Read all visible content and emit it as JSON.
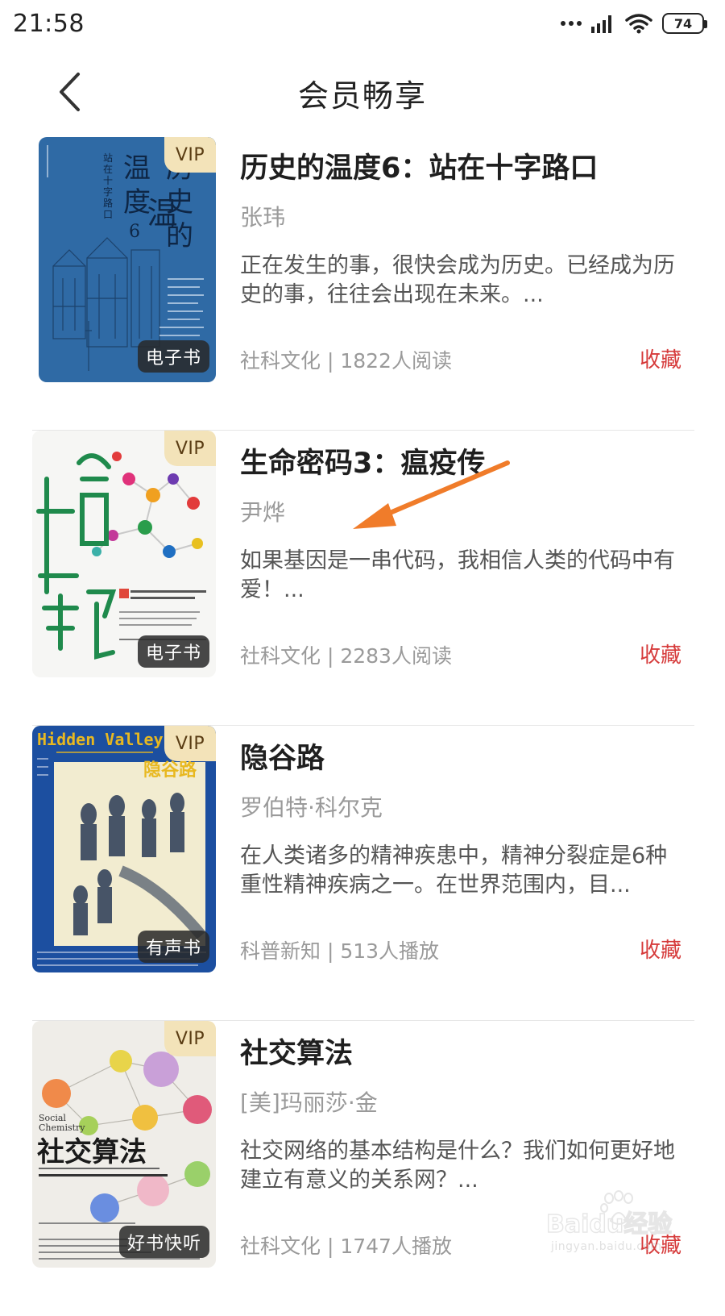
{
  "status_bar": {
    "time": "21:58",
    "battery": "74"
  },
  "header": {
    "title": "会员畅享"
  },
  "books": [
    {
      "title": "历史的温度6：站在十字路口",
      "author": "张玮",
      "description": "正在发生的事，很快会成为历史。已经成为历史的事，往往会出现在未来。...",
      "meta": "社科文化 | 1822人阅读",
      "vip": "VIP",
      "type": "电子书",
      "action": "收藏"
    },
    {
      "title": "生命密码3：瘟疫传",
      "author": "尹烨",
      "description": "如果基因是一串代码，我相信人类的代码中有爱！...",
      "meta": "社科文化 | 2283人阅读",
      "vip": "VIP",
      "type": "电子书",
      "action": "收藏"
    },
    {
      "title": "隐谷路",
      "author": "罗伯特·科尔克",
      "description": "在人类诸多的精神疾患中，精神分裂症是6种重性精神疾病之一。在世界范围内，目...",
      "meta": "科普新知 | 513人播放",
      "vip": "VIP",
      "type": "有声书",
      "action": "收藏"
    },
    {
      "title": "社交算法",
      "author": "[美]玛丽莎·金",
      "description": "社交网络的基本结构是什么？我们如何更好地建立有意义的关系网？...",
      "meta": "社科文化 | 1747人播放",
      "vip": "VIP",
      "type": "好书快听",
      "action": "收藏"
    }
  ],
  "covers": {
    "book1": {
      "title_text": "历史的温度6"
    },
    "book2": {
      "title_text": "生命密码"
    },
    "book3": {
      "title_en": "Hidden Valley",
      "title_zh": "隐谷路"
    },
    "book4": {
      "title_en_1": "Social",
      "title_en_2": "Chemistry",
      "title_zh": "社交算法"
    }
  },
  "watermark": {
    "brand": "Baidu经验",
    "url": "jingyan.baidu.com"
  },
  "colors": {
    "accent_red": "#d63a3a",
    "annotation_orange": "#f07c2a",
    "vip_bg": "#f3e3b9"
  }
}
